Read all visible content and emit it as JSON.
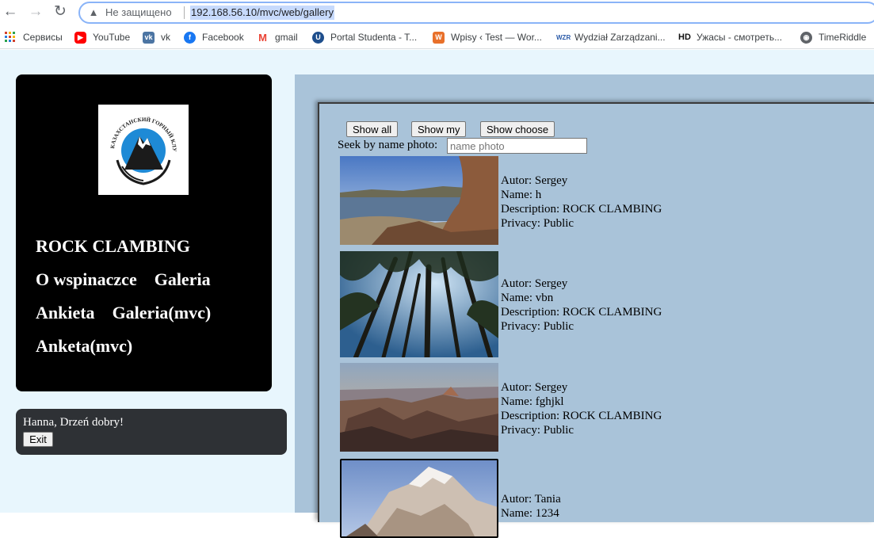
{
  "browser": {
    "security_label": "Не защищено",
    "url": "192.168.56.10/mvc/web/gallery",
    "bookmarks": [
      {
        "label": "Сервисы",
        "icon": "apps-grid-icon"
      },
      {
        "label": "YouTube",
        "icon": "youtube-icon",
        "color": "#ff0000"
      },
      {
        "label": "vk",
        "icon": "vk-icon",
        "color": "#4c75a3"
      },
      {
        "label": "Facebook",
        "icon": "facebook-icon",
        "color": "#1877f2"
      },
      {
        "label": "gmail",
        "icon": "gmail-icon",
        "color": "#ea4335"
      },
      {
        "label": "Portal Studenta - T...",
        "icon": "portal-icon",
        "color": "#1e4e8c"
      },
      {
        "label": "Wpisy ‹ Test — Wor...",
        "icon": "wordpress-icon",
        "color": "#e8702a"
      },
      {
        "label": "Wydział Zarządzani...",
        "icon": "wzr-icon",
        "color": "#2a5aa8"
      },
      {
        "label": "Ужасы - смотреть...",
        "icon": "hd-icon",
        "color": "#111111"
      },
      {
        "label": "TimeRiddle",
        "icon": "globe-icon",
        "color": "#5f6368"
      }
    ]
  },
  "site": {
    "logo_text": "КАЗАХСТАНСКИЙ ГОРНЫЙ КЛУБ",
    "nav": {
      "brand": "ROCK CLAMBING",
      "about": "O wspinaczce",
      "gallery": "Galeria",
      "survey": "Ankieta",
      "gallery_mvc": "Galeria(mvc)",
      "survey_mvc": "Anketa(mvc)"
    },
    "user": {
      "greeting": "Hanna, Drzeń dobry!",
      "exit_label": "Exit"
    }
  },
  "gallery": {
    "buttons": {
      "show_all": "Show all",
      "show_my": "Show my",
      "show_choose": "Show choose"
    },
    "seek_label": "Seek by name photo:",
    "seek_placeholder": "name photo",
    "items": [
      {
        "author": "Autor: Sergey",
        "name": "Name: h",
        "description": "Description: ROCK CLAMBING",
        "privacy": "Privacy: Public"
      },
      {
        "author": "Autor: Sergey",
        "name": "Name: vbn",
        "description": "Description: ROCK CLAMBING",
        "privacy": "Privacy: Public"
      },
      {
        "author": "Autor: Sergey",
        "name": "Name: fghjkl",
        "description": "Description: ROCK CLAMBING",
        "privacy": "Privacy: Public"
      },
      {
        "author": "Autor: Tania",
        "name": "Name: 1234",
        "description": "",
        "privacy": ""
      }
    ]
  },
  "colors": {
    "page_bg": "#e8f6fd",
    "panel_bg": "#000000",
    "gallery_bg": "#a9c3d9",
    "user_panel_bg": "#2e3135"
  }
}
